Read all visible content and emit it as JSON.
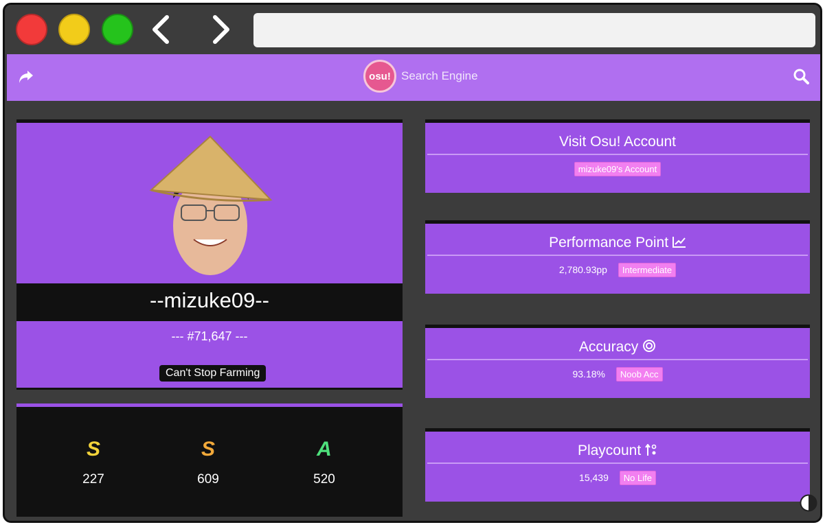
{
  "app": {
    "brand_text": "Search Engine",
    "logo_text": "osu!"
  },
  "profile": {
    "username": "--mizuke09--",
    "rank": "--- #71,647 ---",
    "title_badge": "Can't Stop Farming"
  },
  "grades": [
    {
      "letter": "S",
      "count": "227",
      "color": "#f2d23a"
    },
    {
      "letter": "S",
      "count": "609",
      "color": "#f2a93a"
    },
    {
      "letter": "A",
      "count": "520",
      "color": "#4ee07c"
    }
  ],
  "cards": {
    "account": {
      "title": "Visit Osu! Account",
      "link": "mizuke09's Account"
    },
    "pp": {
      "title": "Performance Point",
      "value": "2,780.93pp",
      "tag": "Intermediate"
    },
    "accuracy": {
      "title": "Accuracy",
      "value": "93.18%",
      "tag": "Noob Acc"
    },
    "playcount": {
      "title": "Playcount",
      "value": "15,439",
      "tag": "No Life"
    }
  },
  "icons": {
    "share": "share-icon",
    "search": "search-icon",
    "chart": "chart-line-icon",
    "target": "target-icon",
    "sort": "sort-icon",
    "contrast": "contrast-icon"
  },
  "colors": {
    "accent": "#9b52e6",
    "appbar": "#b06ff0",
    "tag": "#f27ff0"
  }
}
